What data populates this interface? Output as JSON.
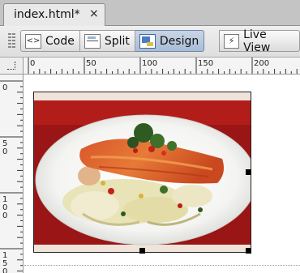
{
  "document_tab": {
    "title": "index.html*",
    "close_glyph": "×"
  },
  "toolbar": {
    "code_label": "Code",
    "split_label": "Split",
    "design_label": "Design",
    "live_view_label": "Live View",
    "active_view": "Design"
  },
  "rulers": {
    "horizontal_labels": [
      "0",
      "50",
      "100",
      "150",
      "200"
    ],
    "vertical_labels": [
      "0",
      "50",
      "100",
      "150"
    ]
  },
  "canvas": {
    "image_icon": "food-photo-salmon-on-plate",
    "image_selected": true
  }
}
